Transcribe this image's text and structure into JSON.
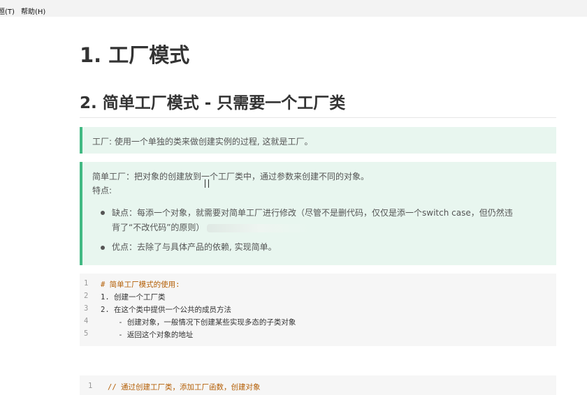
{
  "menubar": {
    "items": [
      "题(T)",
      "帮助(H)"
    ]
  },
  "doc": {
    "h1": "1. 工厂模式",
    "h2": "2. 简单工厂模式 - 只需要一个工厂类",
    "quote1": "工厂: 使用一个单独的类来做创建实例的过程, 这就是工厂。",
    "quote2": {
      "line1": "简单工厂：把对象的创建放到一个工厂类中，通过参数来创建不同的对象。",
      "line2": "特点:",
      "bullet1_l1": "缺点：每添一个对象，就需要对简单工厂进行修改（尽管不是删代码，仅仅是添一个switch case，但仍然违",
      "bullet1_l2": "背了“不改代码”的原则）",
      "bullet2": "优点：去除了与具体产品的依赖, 实现简单。"
    },
    "code1": {
      "lines": [
        {
          "n": "1",
          "t": "# 简单工厂模式的使用:"
        },
        {
          "n": "2",
          "t": "1. 创建一个工厂类"
        },
        {
          "n": "3",
          "t": "2. 在这个类中提供一个公共的成员方法"
        },
        {
          "n": "4",
          "t": "    - 创建对象，一般情况下创建某些实现多态的子类对象"
        },
        {
          "n": "5",
          "t": "    - 返回这个对象的地址"
        }
      ]
    },
    "code2": {
      "lines": [
        {
          "n": "1",
          "t": "// 通过创建工厂类，添加工厂函数，创建对象"
        }
      ]
    }
  }
}
